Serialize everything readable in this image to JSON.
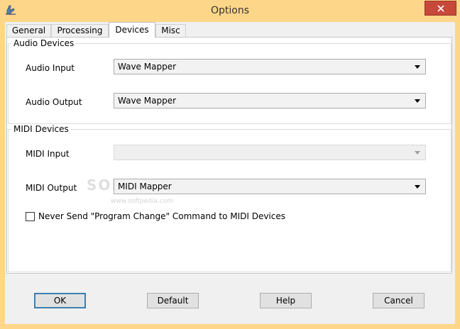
{
  "window": {
    "title": "Options",
    "icon": "app-icon",
    "close_icon": "close-icon",
    "title_bar_color": "#fdd68a",
    "close_color": "#c7493a"
  },
  "tabs": [
    {
      "label": "General",
      "active": false
    },
    {
      "label": "Processing",
      "active": false
    },
    {
      "label": "Devices",
      "active": true
    },
    {
      "label": "Misc",
      "active": false
    }
  ],
  "audio": {
    "group_title": "Audio Devices",
    "input_label": "Audio Input",
    "input_value": "Wave Mapper",
    "output_label": "Audio Output",
    "output_value": "Wave Mapper"
  },
  "midi": {
    "group_title": "MIDI Devices",
    "input_label": "MIDI Input",
    "input_value": "",
    "output_label": "MIDI Output",
    "output_value": "MIDI Mapper",
    "checkbox_label": "Never Send \"Program Change\" Command to MIDI Devices",
    "checkbox_checked": false
  },
  "watermark": {
    "text": "SOFTPEDIA",
    "sub": "www.softpedia.com"
  },
  "buttons": {
    "ok": "OK",
    "default": "Default",
    "help": "Help",
    "cancel": "Cancel"
  }
}
